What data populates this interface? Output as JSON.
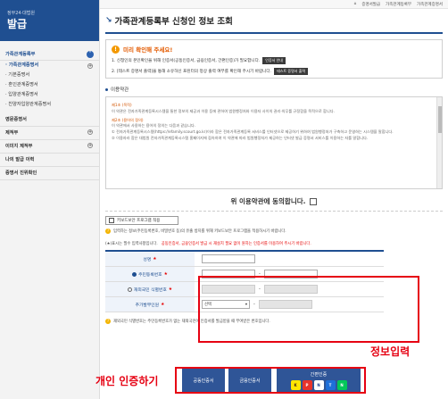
{
  "sidebar": {
    "logo_small": "정부24·대법원",
    "logo_big": "발급",
    "section": "가족관계등록부",
    "sub_items": [
      "· 가족관계증명서",
      "· 기본증명서",
      "· 혼인관계증명서",
      "· 입양관계증명서",
      "· 친양자입양관계증명서"
    ],
    "main_items": [
      "영문증명서",
      "제적부",
      "이미지 제적부",
      "나의 발급 이력",
      "증명서 진위확인"
    ]
  },
  "topbar": {
    "items": [
      "홈",
      "증명서발급",
      "가족관계등록부",
      "가족관계증명서"
    ]
  },
  "page_title": "가족관계등록부 신청인 정보 조회",
  "notice": {
    "title": "미리 확인해 주세요!",
    "line1": "1. 신청인의 본인확인을 위해 인증서(공동인증서, 금융인증서, 간편인증)가 필요합니다.",
    "btn1": "인증서 안내",
    "line2": "2. [테스트 증명서 출력]을 통해 소유하신 프린터의 정상 출력 여부를 확인해 주시기 바랍니다.",
    "btn2": "테스트 증명서 출력"
  },
  "terms": {
    "section_label": "이용약관",
    "h1": "제1조 (목적)",
    "p1": "이 약관은 전자가족관계등록시스템을 통한 정보의 제공과 이용 등에 관하여 법원행정처와 이용자 사이의 권리·의무를 규정함을 목적으로 합니다.",
    "h2": "제2조 (용어의 정의)",
    "p2": "이 약관에서 사용하는 용어의 정의는 다음과 같습니다.",
    "p3": "① 전자가족관계등록시스템(https://efamily.scourt.go.kr)이라 함은 전자가족관계등록 서비스를 인터넷으로 제공하기 위하여 법원행정처가 구축하고 운영하는 시스템을 말합니다.",
    "p4": "② 이용자라 함은 대법원 전자가족관계등록시스템 홈페이지에 접속하여 이 약관에 따라 법원행정처가 제공하는 인터넷 발급 증명서 서비스를 이용하는 자를 말합니다."
  },
  "agree_label": "위 이용약관에 동의합니다.",
  "keyboard_label": "키보드보안 프로그램 적용",
  "keyboard_info": "입력하는 정보(주민등록번호, 비밀번호 등)의 유출 방지를 위해 키보드보안 프로그램을 적용하시기 바랍니다.",
  "required_note": "(★)표시는 필수 입력사항입니다.",
  "required_note2": "공동인증서, 금융인증서 발급 시 재설치 필요 없이 원하는 인증서를 이용하여 주시기 바랍니다.",
  "form": {
    "name": "성명",
    "rrn": "주민등록번호",
    "foreign": "재외국민 식별번호",
    "extra": "추가발부인원",
    "select_value": "선택",
    "star": "★"
  },
  "foot_note": "재외국민 식별번호는 주민등록번호가 없는 재외국민이 인증서를 발급받을 때 부여받은 번호입니다.",
  "annotation_info": "정보입력",
  "annotation_auth": "개인 인증하기",
  "buttons": {
    "cert1": "공동인증서",
    "cert2": "금융인증서",
    "simple_title": "간편인증",
    "simple_logos": [
      "K",
      "P",
      "N",
      "T",
      "N"
    ]
  }
}
